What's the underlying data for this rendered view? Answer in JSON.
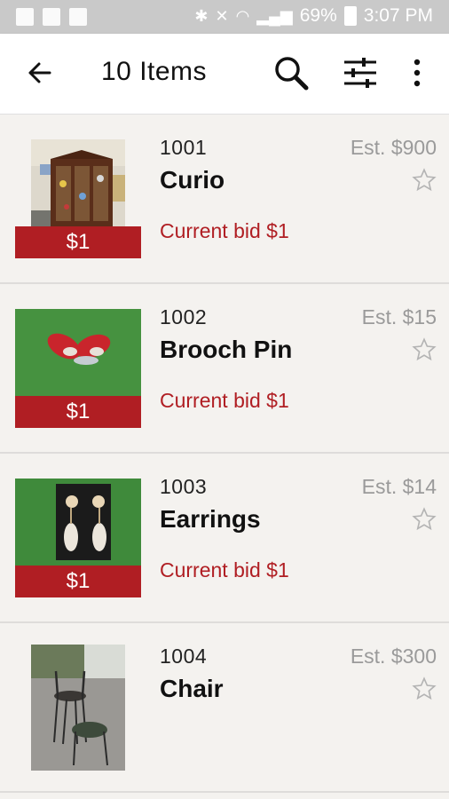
{
  "status_bar": {
    "battery": "69%",
    "time": "3:07 PM"
  },
  "app_bar": {
    "title": "10 Items",
    "icons": [
      "arrow-back-icon",
      "search-icon",
      "filter-sliders-icon",
      "more-vert-icon"
    ]
  },
  "items": [
    {
      "lot": "1001",
      "name": "Curio",
      "estimate": "Est. $900",
      "current_bid": "Current bid $1",
      "price_tag": "$1"
    },
    {
      "lot": "1002",
      "name": "Brooch Pin",
      "estimate": "Est. $15",
      "current_bid": "Current bid $1",
      "price_tag": "$1"
    },
    {
      "lot": "1003",
      "name": "Earrings",
      "estimate": "Est. $14",
      "current_bid": "Current bid $1",
      "price_tag": "$1"
    },
    {
      "lot": "1004",
      "name": "Chair",
      "estimate": "Est. $300"
    }
  ],
  "colors": {
    "accent": "#b01e23",
    "background": "#f4f2ef"
  }
}
